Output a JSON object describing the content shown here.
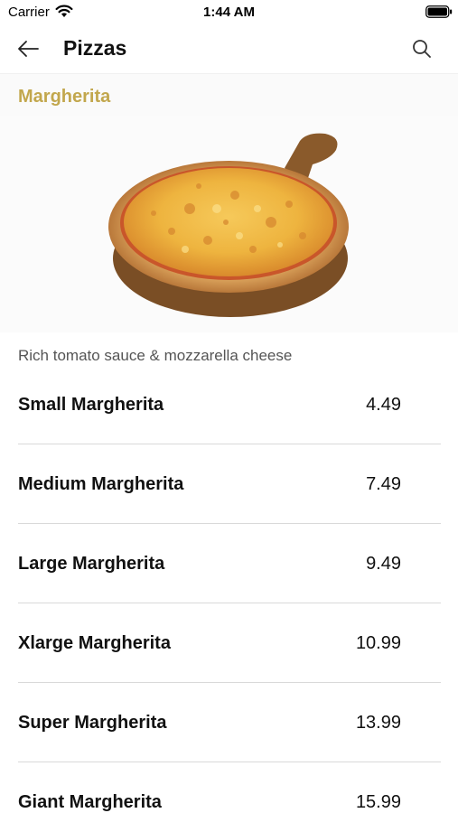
{
  "status_bar": {
    "carrier": "Carrier",
    "time": "1:44 AM",
    "wifi_icon": "wifi-icon",
    "battery_icon": "battery-icon"
  },
  "nav": {
    "title": "Pizzas",
    "back_icon": "arrow-left-icon",
    "search_icon": "search-icon"
  },
  "product": {
    "name": "Margherita",
    "image": "margherita-pizza-on-wooden-board",
    "description": "Rich tomato sauce & mozzarella cheese",
    "accent_color": "#c2a74d"
  },
  "menu_items": [
    {
      "name": "Small Margherita",
      "price": "4.49"
    },
    {
      "name": "Medium Margherita",
      "price": "7.49"
    },
    {
      "name": "Large Margherita",
      "price": "9.49"
    },
    {
      "name": "Xlarge Margherita",
      "price": "10.99"
    },
    {
      "name": "Super Margherita",
      "price": "13.99"
    },
    {
      "name": "Giant Margherita",
      "price": "15.99"
    }
  ]
}
